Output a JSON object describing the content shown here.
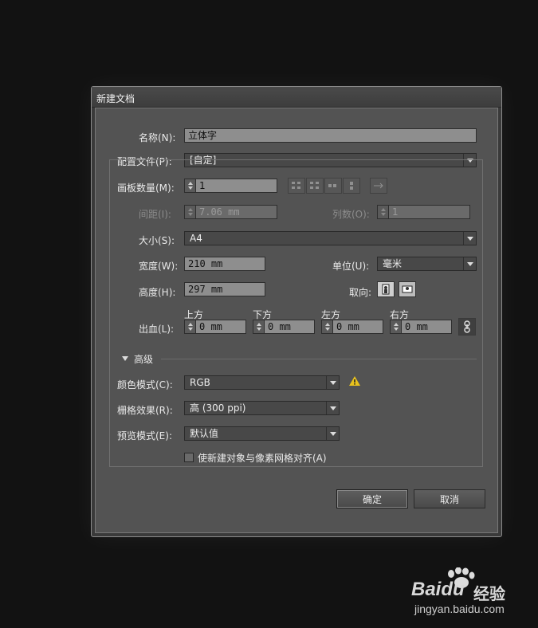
{
  "dialog": {
    "title": "新建文档",
    "name": {
      "label": "名称(N):",
      "value": "立体字"
    },
    "profile": {
      "label": "配置文件(P):",
      "value": "[自定]"
    },
    "artboard_count": {
      "label": "画板数量(M):",
      "value": "1"
    },
    "spacing": {
      "label": "间距(I):",
      "value": "7.06 mm"
    },
    "columns": {
      "label": "列数(O):",
      "value": "1"
    },
    "size": {
      "label": "大小(S):",
      "value": "A4"
    },
    "width": {
      "label": "宽度(W):",
      "value": "210 mm"
    },
    "units": {
      "label": "单位(U):",
      "value": "毫米"
    },
    "height": {
      "label": "高度(H):",
      "value": "297 mm"
    },
    "orientation": {
      "label": "取向:"
    },
    "bleed": {
      "label": "出血(L):",
      "top": {
        "label": "上方",
        "value": "0 mm"
      },
      "bottom": {
        "label": "下方",
        "value": "0 mm"
      },
      "left": {
        "label": "左方",
        "value": "0 mm"
      },
      "right": {
        "label": "右方",
        "value": "0 mm"
      }
    },
    "advanced": {
      "label": "高级"
    },
    "color_mode": {
      "label": "颜色模式(C):",
      "value": "RGB"
    },
    "raster_effects": {
      "label": "栅格效果(R):",
      "value": "高 (300 ppi)"
    },
    "preview_mode": {
      "label": "预览模式(E):",
      "value": "默认值"
    },
    "align_pixel_grid": {
      "label": "使新建对象与像素网格对齐(A)",
      "checked": false
    },
    "ok_label": "确定",
    "cancel_label": "取消"
  },
  "watermark": {
    "brand": "Baidu",
    "brand_suffix": "经验",
    "url": "jingyan.baidu.com"
  },
  "colors": {
    "warning": "#e8c21e",
    "field_bg": "#8e8e8e",
    "panel_bg": "#535353"
  },
  "icons": [
    "chevron-down-icon",
    "warning-icon",
    "link-icon",
    "portrait-icon",
    "landscape-icon",
    "arrange-grid-icon",
    "arrow-right-icon"
  ]
}
